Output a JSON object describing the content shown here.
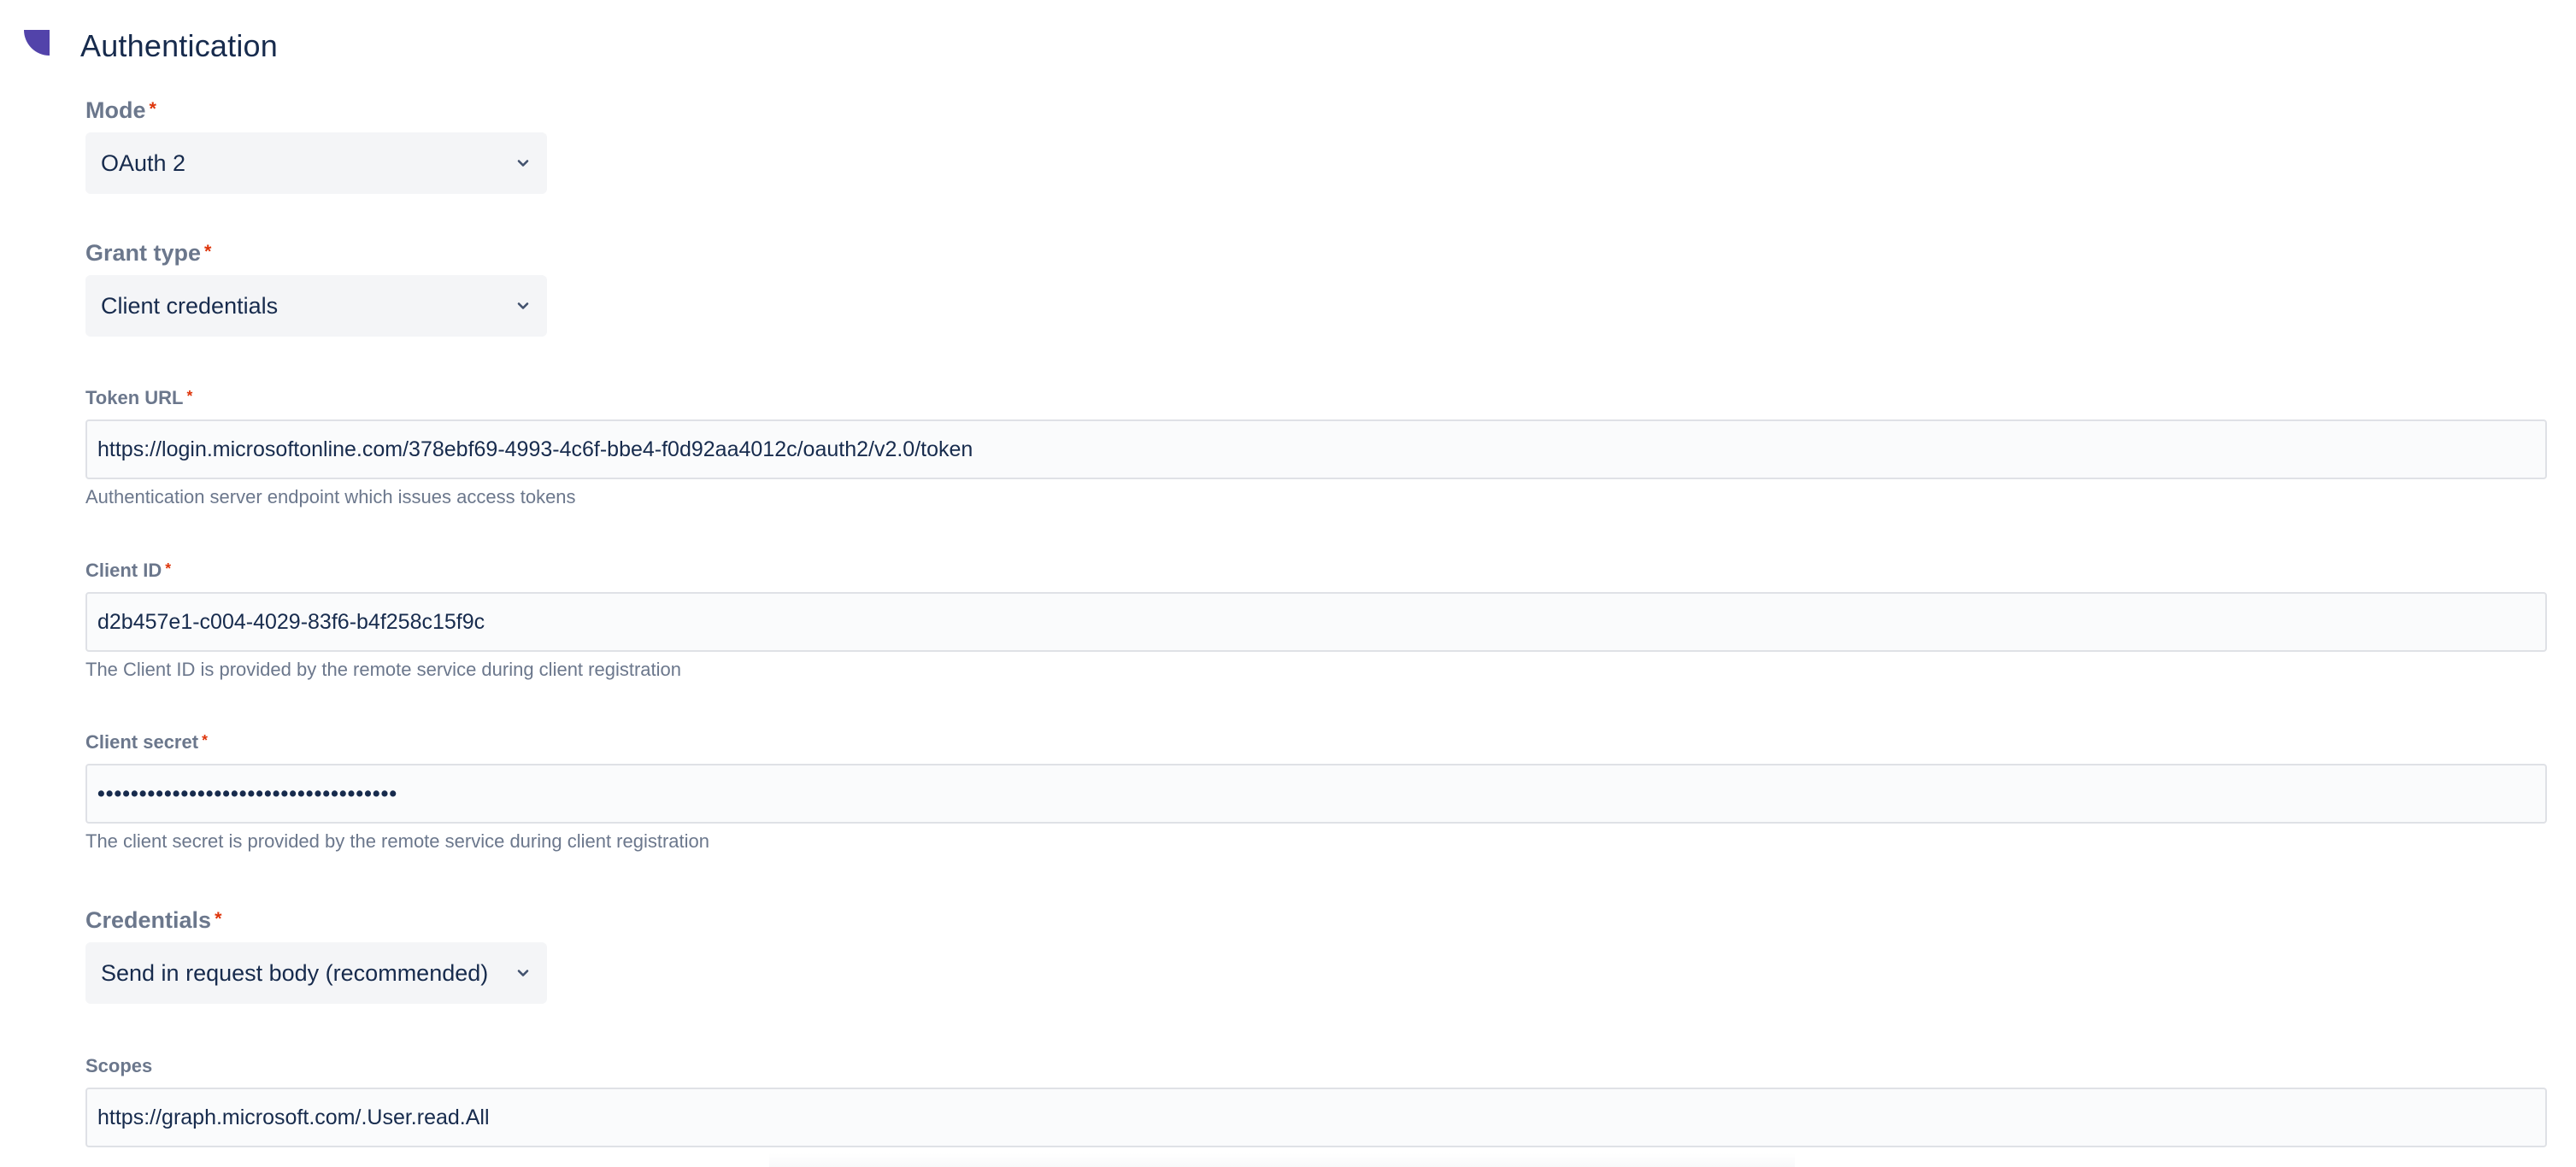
{
  "section": {
    "title": "Authentication",
    "icon": "section-bookmark-icon",
    "accent_color": "#5243aa"
  },
  "required_marker": "*",
  "fields": {
    "mode": {
      "label": "Mode",
      "value": "OAuth 2"
    },
    "grant_type": {
      "label": "Grant type",
      "value": "Client credentials"
    },
    "token_url": {
      "label": "Token URL",
      "value": "https://login.microsoftonline.com/378ebf69-4993-4c6f-bbe4-f0d92aa4012c/oauth2/v2.0/token",
      "helper": "Authentication server endpoint which issues access tokens"
    },
    "client_id": {
      "label": "Client ID",
      "value": "d2b457e1-c004-4029-83f6-b4f258c15f9c",
      "helper": "The Client ID is provided by the remote service during client registration"
    },
    "client_secret": {
      "label": "Client secret",
      "value": "••••••••••••••••••••••••••••••••••••",
      "helper": "The client secret is provided by the remote service during client registration"
    },
    "credentials": {
      "label": "Credentials",
      "value": "Send in request body (recommended)"
    },
    "scopes": {
      "label": "Scopes",
      "value": "https://graph.microsoft.com/.User.read.All"
    }
  }
}
